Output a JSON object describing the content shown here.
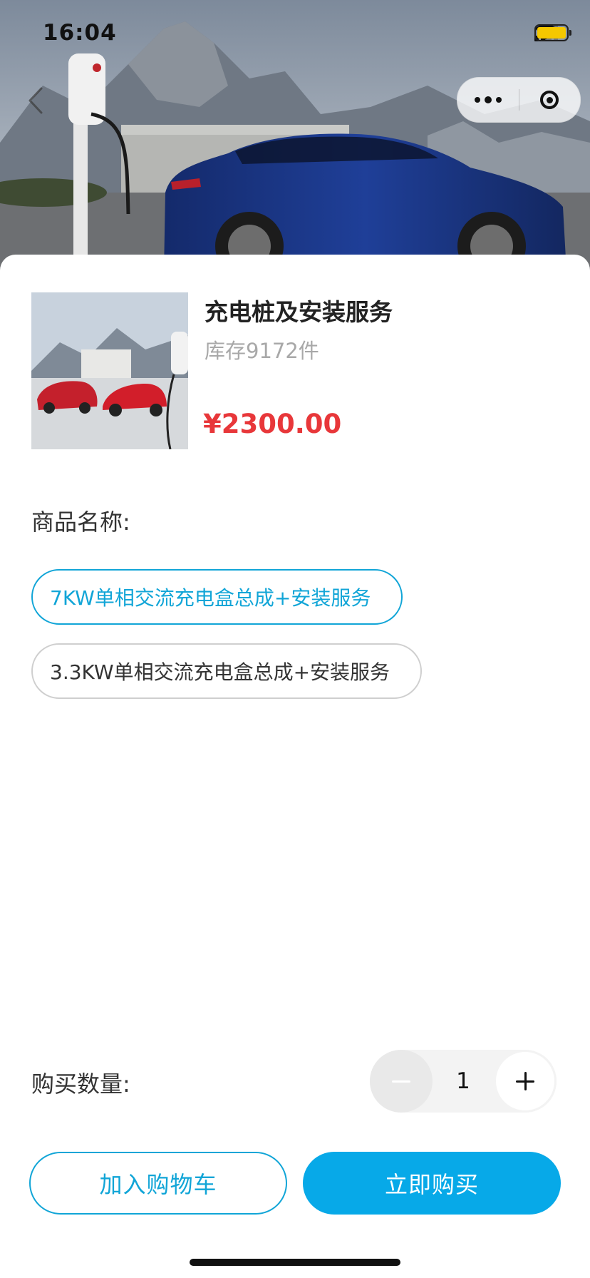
{
  "status_bar": {
    "time": "16:04",
    "signal_icon": "cellular-signal-icon",
    "wifi_icon": "wifi-icon",
    "battery_icon": "battery-icon",
    "battery_color": "#f5c800"
  },
  "nav": {
    "back_icon": "chevron-left-icon",
    "capsule_more_icon": "more-dots-icon",
    "capsule_close_icon": "target-close-icon"
  },
  "product": {
    "title": "充电桩及安装服务",
    "stock": "库存9172件",
    "price": "¥2300.00",
    "price_color": "#e8373a"
  },
  "spec": {
    "label": "商品名称:",
    "options": [
      {
        "label": "7KW单相交流充电盒总成+安装服务",
        "selected": true
      },
      {
        "label": "3.3KW单相交流充电盒总成+安装服务",
        "selected": false
      }
    ],
    "accent_color": "#11a5d7"
  },
  "quantity": {
    "label": "购买数量:",
    "value": "1"
  },
  "actions": {
    "add_to_cart": "加入购物车",
    "buy_now": "立即购买",
    "buy_color": "#07a9e8"
  }
}
